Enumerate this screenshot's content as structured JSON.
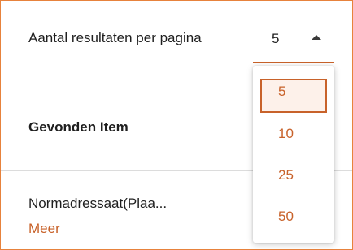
{
  "pagination": {
    "label": "Aantal resultaten per pagina",
    "selected_value": "5",
    "options": [
      "5",
      "10",
      "25",
      "50"
    ]
  },
  "table": {
    "header": "Gevonden Item",
    "rows": [
      {
        "text": "Normadressaat(Plaa...",
        "more": "Meer"
      }
    ]
  },
  "colors": {
    "accent": "#c8622a",
    "panel_border": "#e7823c",
    "selected_bg": "#fdf1ea"
  }
}
